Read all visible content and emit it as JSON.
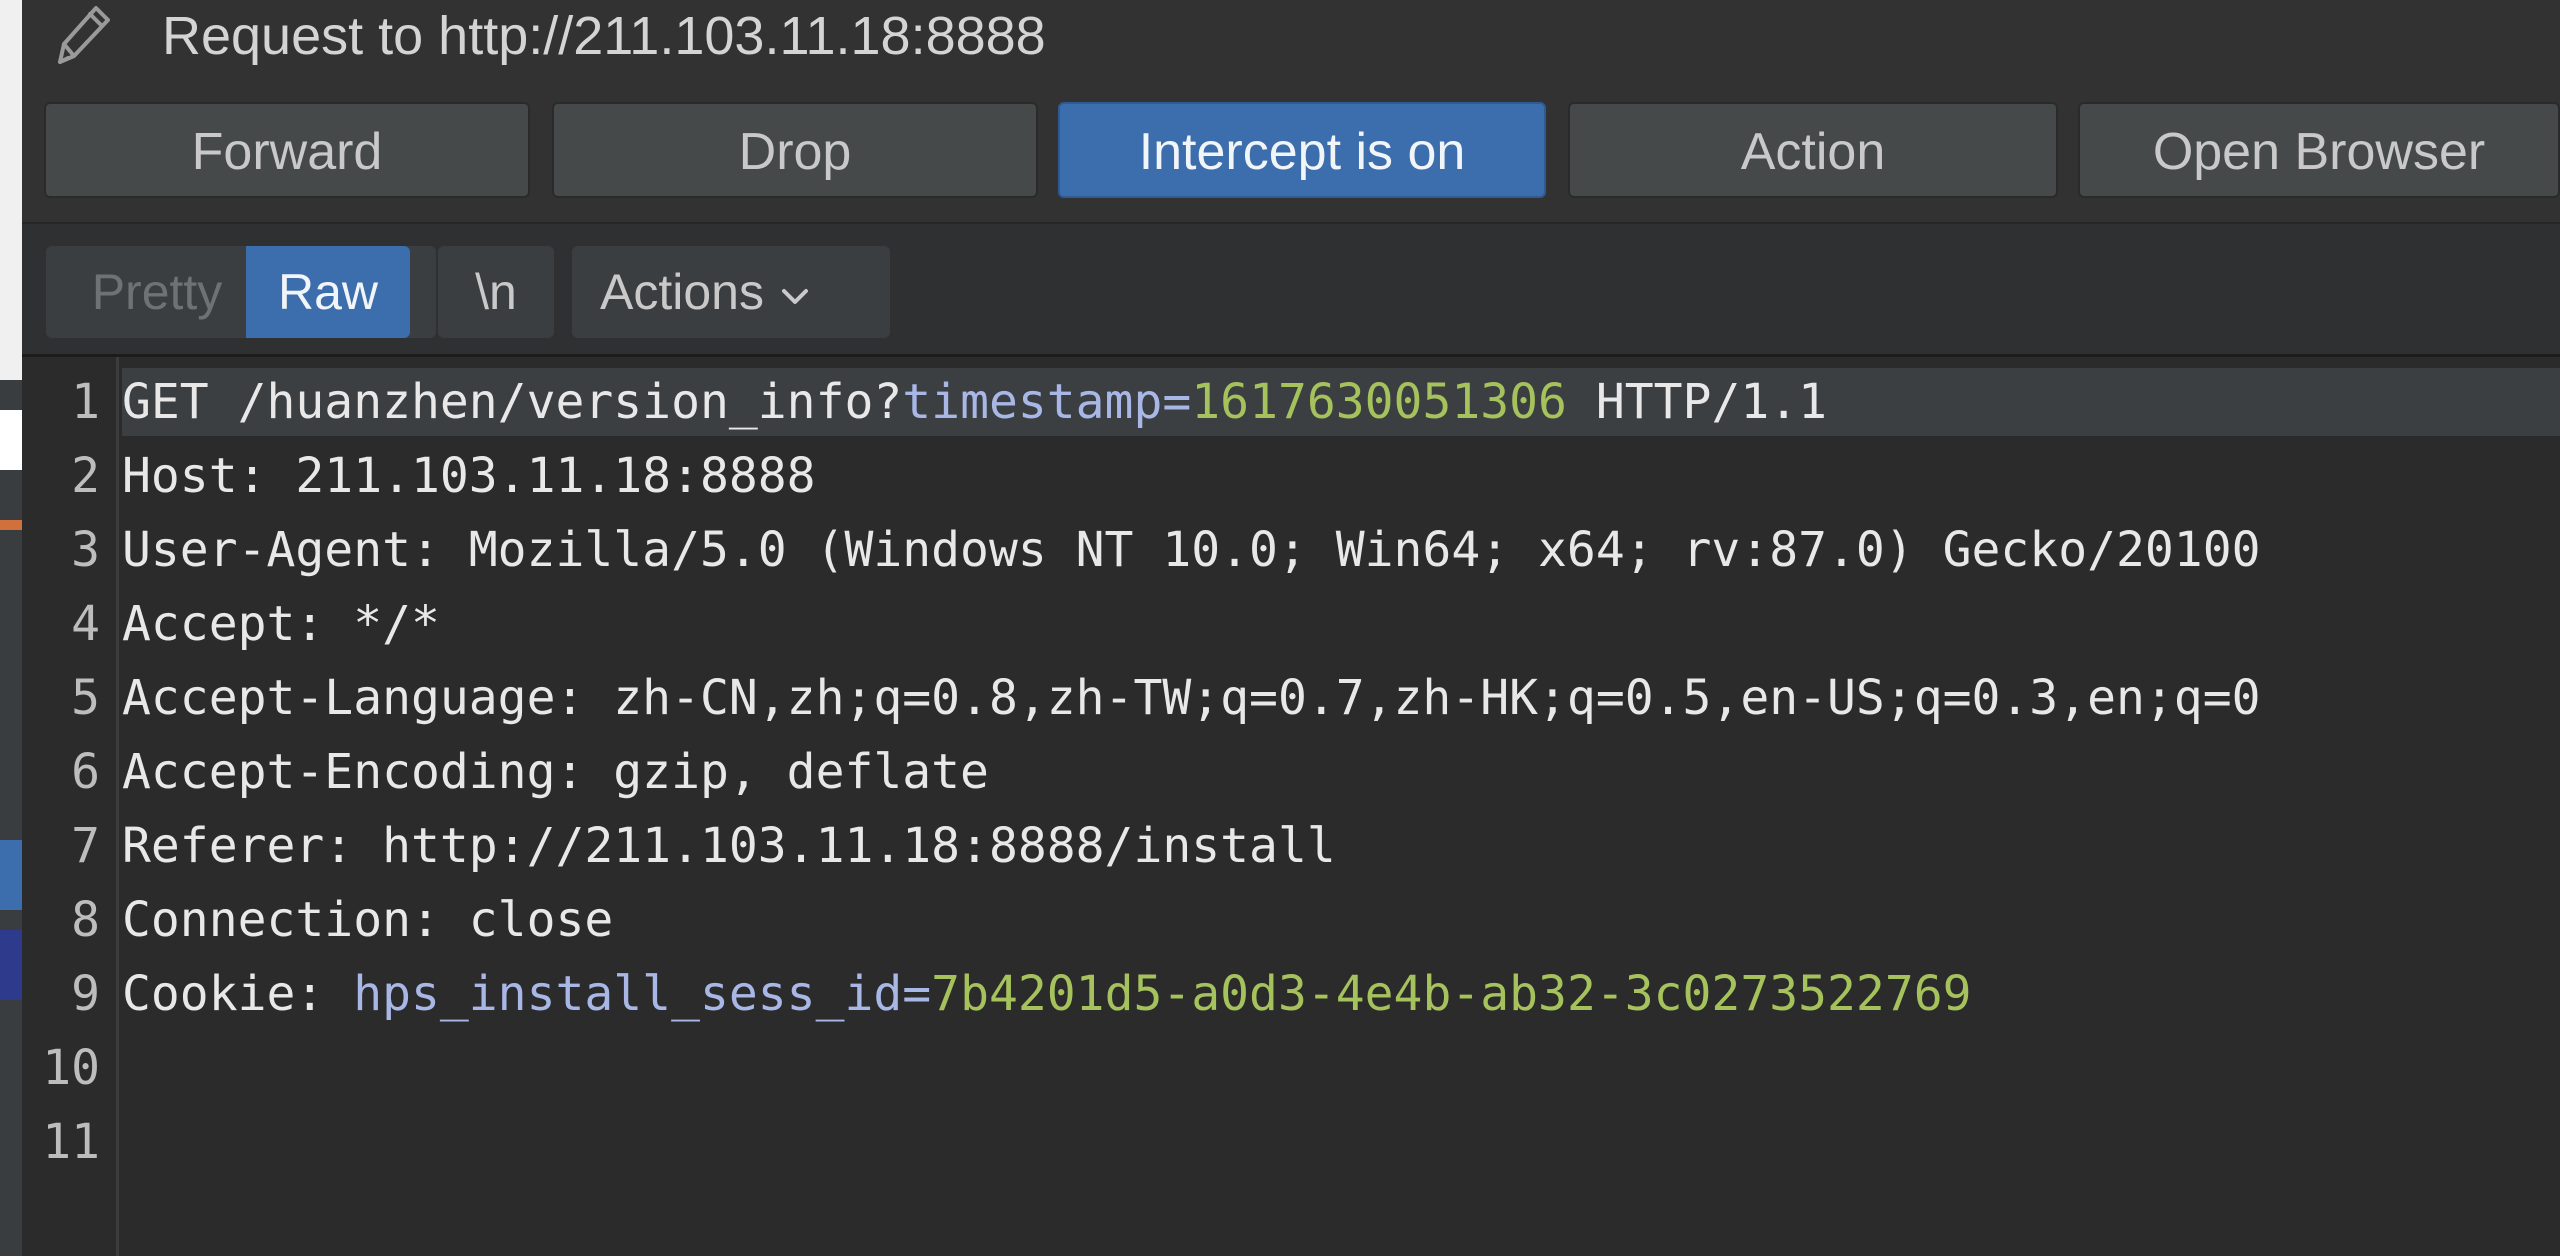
{
  "window": {
    "title": "Request to http://211.103.11.18:8888"
  },
  "toolbar": {
    "forward": "Forward",
    "drop": "Drop",
    "intercept": "Intercept is on",
    "action": "Action",
    "open_browser": "Open Browser"
  },
  "view_tabs": {
    "pretty": "Pretty",
    "raw": "Raw",
    "newline": "\\n",
    "actions": "Actions"
  },
  "editor": {
    "line_numbers": [
      "1",
      "2",
      "3",
      "4",
      "5",
      "6",
      "7",
      "8",
      "9",
      "10",
      "11"
    ],
    "request_line": {
      "prefix": "GET /huanzhen/version_info?",
      "param_name": "timestamp",
      "equals": "=",
      "param_value": "1617630051306",
      "suffix": " HTTP/1.1"
    },
    "host": "Host: 211.103.11.18:8888",
    "user_agent": "User-Agent: Mozilla/5.0 (Windows NT 10.0; Win64; x64; rv:87.0) Gecko/20100",
    "accept": "Accept: */*",
    "accept_language": "Accept-Language: zh-CN,zh;q=0.8,zh-TW;q=0.7,zh-HK;q=0.5,en-US;q=0.3,en;q=0",
    "accept_encoding": "Accept-Encoding: gzip, deflate",
    "referer": "Referer: http://211.103.11.18:8888/install",
    "connection": "Connection: close",
    "cookie": {
      "label": "Cookie: ",
      "name": "hps_install_sess_id",
      "equals": "=",
      "value": "7b4201d5-a0d3-4e4b-ab32-3c0273522769"
    }
  },
  "colors": {
    "accent": "#3c6dad",
    "param_name": "#a9b7e6",
    "param_value": "#a5c25c"
  },
  "icons": {
    "title": "pencil-icon",
    "actions_menu": "chevron-down-icon"
  }
}
